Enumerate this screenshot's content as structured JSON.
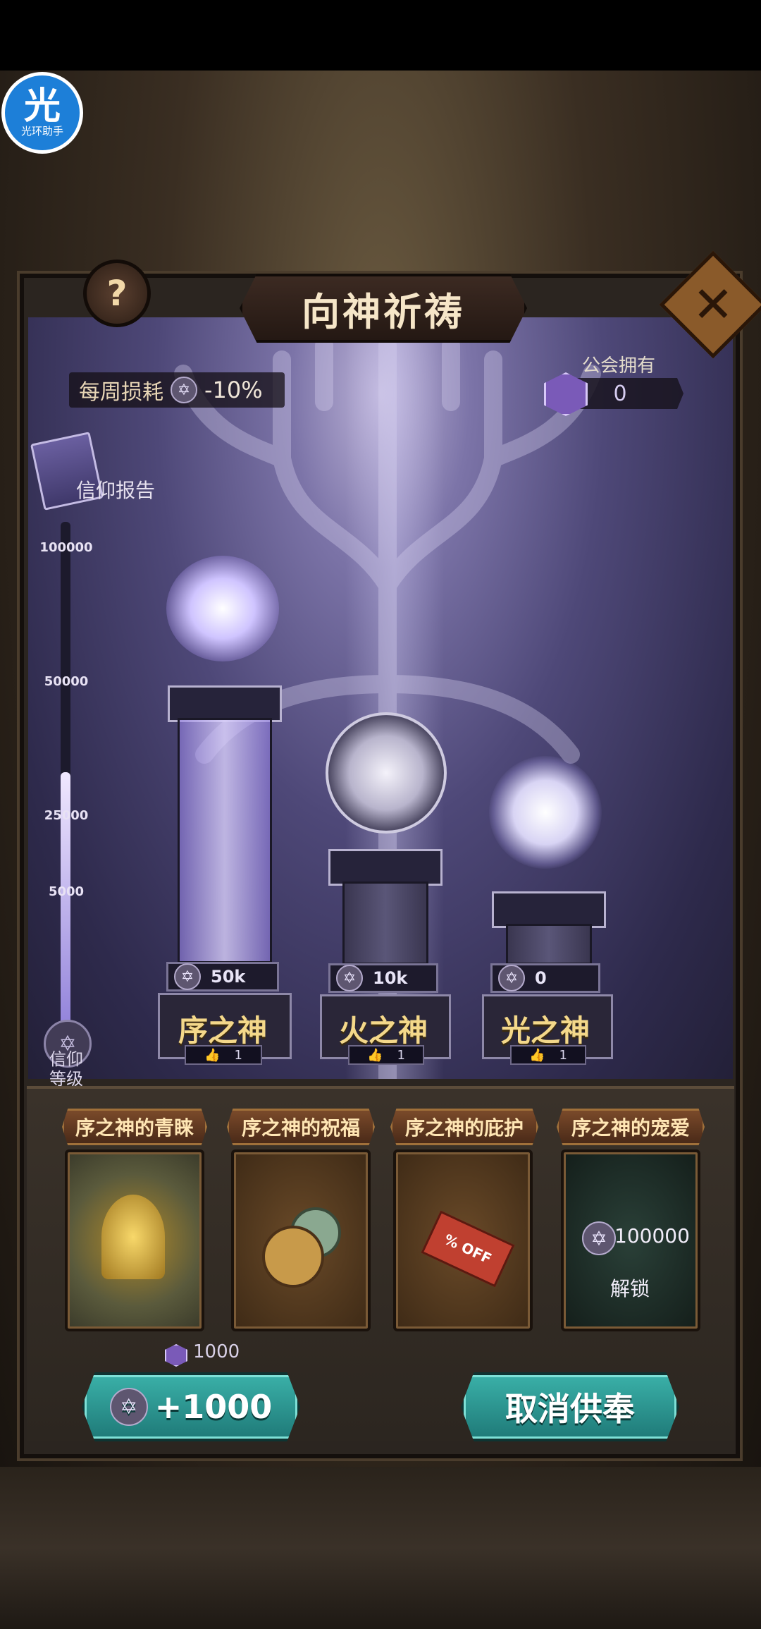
{
  "helper": {
    "big": "光",
    "small": "光环助手"
  },
  "header": {
    "title": "向神祈祷",
    "help_label": "?",
    "close_label": "✕"
  },
  "info": {
    "weekly_label": "每周损耗",
    "weekly_value": "-10%",
    "guild_label": "公会拥有",
    "guild_value": "0",
    "report_label": "信仰报告"
  },
  "faith_bar": {
    "ticks": [
      "100000",
      "50000",
      "25000",
      "5000"
    ],
    "level_label": "信仰\n等级",
    "fill_fraction": 0.52
  },
  "gods": [
    {
      "name": "序之神",
      "score": "50k",
      "likes": "1"
    },
    {
      "name": "火之神",
      "score": "10k",
      "likes": "1"
    },
    {
      "name": "光之神",
      "score": "0",
      "likes": "1"
    }
  ],
  "blessings": [
    {
      "title": "序之神的青睐",
      "cost": "1000"
    },
    {
      "title": "序之神的祝福"
    },
    {
      "title": "序之神的庇护",
      "tag_text": "% OFF"
    },
    {
      "title": "序之神的宠爱",
      "lock_value": "100000",
      "lock_text": "解锁"
    }
  ],
  "buttons": {
    "offer": "+1000",
    "cancel": "取消供奉"
  },
  "colors": {
    "accent_gold": "#f4d88a",
    "button_teal": "#2a9a94",
    "faith_purple": "#7a5ab8"
  },
  "icons": {
    "faith": "hexagram-icon",
    "guild": "gem-icon",
    "like": "thumb-icon"
  }
}
